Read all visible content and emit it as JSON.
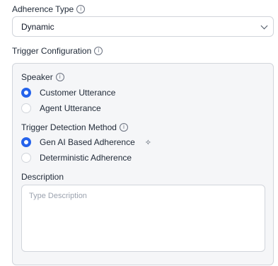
{
  "adherence_type": {
    "label": "Adherence Type",
    "info_icon": "info-icon",
    "selected": "Dynamic",
    "dropdown_icon": "chevron-down-icon"
  },
  "trigger_configuration": {
    "label": "Trigger Configuration",
    "info_icon": "info-icon",
    "speaker": {
      "label": "Speaker",
      "options": [
        {
          "label": "Customer Utterance",
          "checked": true
        },
        {
          "label": "Agent Utterance",
          "checked": false
        }
      ]
    },
    "trigger_detection_method": {
      "label": "Trigger Detection Method",
      "options": [
        {
          "label": "Gen AI Based Adherence",
          "checked": true,
          "icon": "sparkle-icon"
        },
        {
          "label": "Deterministic Adherence",
          "checked": false
        }
      ]
    },
    "description": {
      "label": "Description",
      "placeholder": "Type Description",
      "value": ""
    }
  },
  "colors": {
    "accent": "#2563eb",
    "border": "#d1d5db",
    "panel_bg": "#f5f6f8",
    "text": "#1f2937",
    "placeholder": "#9ca3af"
  }
}
